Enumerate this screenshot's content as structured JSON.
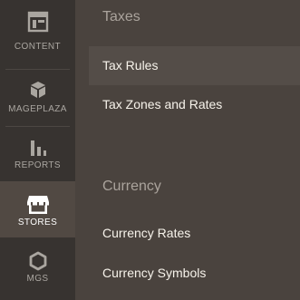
{
  "sidebar": {
    "items": [
      {
        "label": "CONTENT",
        "icon": "content-layout-icon",
        "active": false
      },
      {
        "label": "MAGEPLAZA",
        "icon": "cube-icon",
        "active": false
      },
      {
        "label": "REPORTS",
        "icon": "bar-chart-icon",
        "active": false
      },
      {
        "label": "STORES",
        "icon": "storefront-icon",
        "active": true
      },
      {
        "label": "MGS",
        "icon": "hexagon-icon",
        "active": false
      }
    ]
  },
  "panel": {
    "sections": [
      {
        "title": "Taxes",
        "links": [
          "Tax Rules",
          "Tax Zones and Rates"
        ]
      },
      {
        "title": "Currency",
        "links": [
          "Currency Rates",
          "Currency Symbols"
        ]
      }
    ]
  },
  "colors": {
    "sidebar_bg": "#373330",
    "panel_bg": "#4a433e",
    "active_item_bg": "#514943",
    "link_text": "#f7f3eb",
    "section_title": "#aaa39c"
  }
}
